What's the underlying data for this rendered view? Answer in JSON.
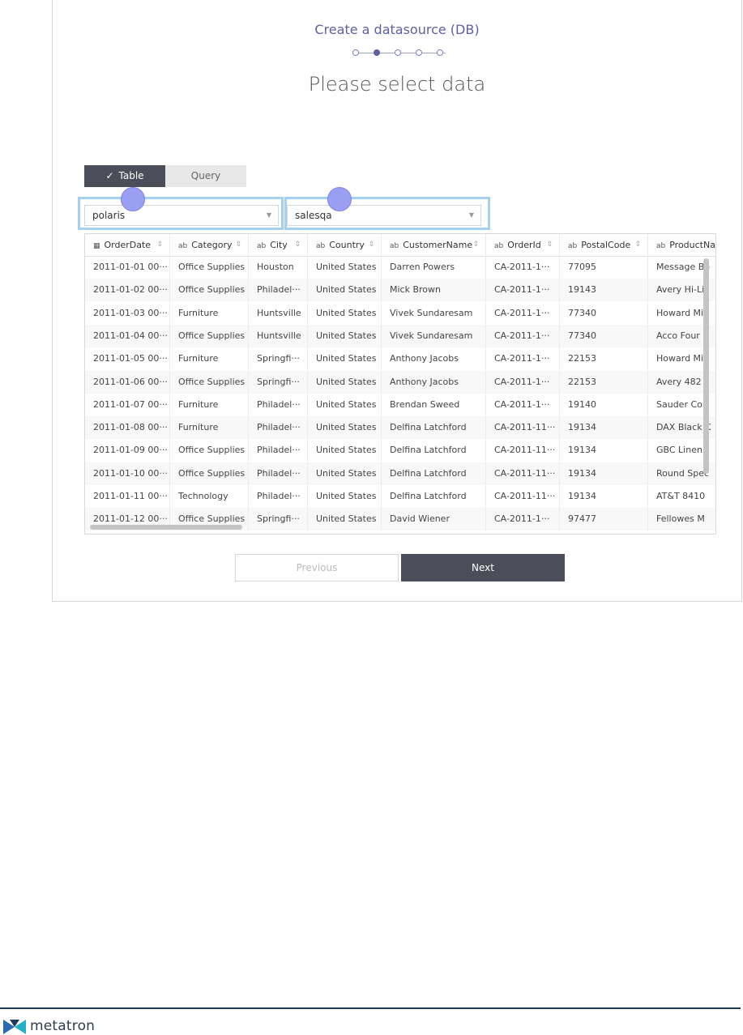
{
  "wizard": {
    "title": "Create a datasource (DB)",
    "heading": "Please select data",
    "current_step": 2,
    "total_steps": 5
  },
  "toggle": {
    "table_label": "Table",
    "query_label": "Query",
    "selected": "Table"
  },
  "database_select": {
    "value": "polaris"
  },
  "table_select": {
    "value": "salesqa"
  },
  "grid": {
    "columns": [
      {
        "type": "date",
        "label": "OrderDate"
      },
      {
        "type": "ab",
        "label": "Category"
      },
      {
        "type": "ab",
        "label": "City"
      },
      {
        "type": "ab",
        "label": "Country"
      },
      {
        "type": "ab",
        "label": "CustomerName"
      },
      {
        "type": "ab",
        "label": "OrderId"
      },
      {
        "type": "ab",
        "label": "PostalCode"
      },
      {
        "type": "ab",
        "label": "ProductNa"
      }
    ],
    "rows": [
      [
        "2011-01-01 00···",
        "Office Supplies",
        "Houston",
        "United States",
        "Darren Powers",
        "CA-2011-1···",
        "77095",
        "Message Bo"
      ],
      [
        "2011-01-02 00···",
        "Office Supplies",
        "Philadel···",
        "United States",
        "Mick Brown",
        "CA-2011-1···",
        "19143",
        "Avery Hi-Li"
      ],
      [
        "2011-01-03 00···",
        "Furniture",
        "Huntsville",
        "United States",
        "Vivek Sundaresam",
        "CA-2011-1···",
        "77340",
        "Howard Mil"
      ],
      [
        "2011-01-04 00···",
        "Office Supplies",
        "Huntsville",
        "United States",
        "Vivek Sundaresam",
        "CA-2011-1···",
        "77340",
        "Acco Four F"
      ],
      [
        "2011-01-05 00···",
        "Furniture",
        "Springfi···",
        "United States",
        "Anthony Jacobs",
        "CA-2011-1···",
        "22153",
        "Howard Mil"
      ],
      [
        "2011-01-06 00···",
        "Office Supplies",
        "Springfi···",
        "United States",
        "Anthony Jacobs",
        "CA-2011-1···",
        "22153",
        "Avery 482"
      ],
      [
        "2011-01-07 00···",
        "Furniture",
        "Philadel···",
        "United States",
        "Brendan Sweed",
        "CA-2011-1···",
        "19140",
        "Sauder Cor"
      ],
      [
        "2011-01-08 00···",
        "Furniture",
        "Philadel···",
        "United States",
        "Delfina Latchford",
        "CA-2011-11···",
        "19134",
        "DAX Black C"
      ],
      [
        "2011-01-09 00···",
        "Office Supplies",
        "Philadel···",
        "United States",
        "Delfina Latchford",
        "CA-2011-11···",
        "19134",
        "GBC Linen"
      ],
      [
        "2011-01-10 00···",
        "Office Supplies",
        "Philadel···",
        "United States",
        "Delfina Latchford",
        "CA-2011-11···",
        "19134",
        "Round Spec"
      ],
      [
        "2011-01-11 00···",
        "Technology",
        "Philadel···",
        "United States",
        "Delfina Latchford",
        "CA-2011-11···",
        "19134",
        "AT&T 8410"
      ],
      [
        "2011-01-12 00···",
        "Office Supplies",
        "Springfi···",
        "United States",
        "David Wiener",
        "CA-2011-1···",
        "97477",
        "Fellowes M"
      ]
    ]
  },
  "buttons": {
    "previous": "Previous",
    "next": "Next"
  },
  "footer": {
    "brand": "metatron"
  },
  "colors": {
    "accent": "#5d5fa3",
    "dark_button": "#4b4e58",
    "highlight": "#a6d0ef",
    "marker": "#9a9ff4"
  }
}
